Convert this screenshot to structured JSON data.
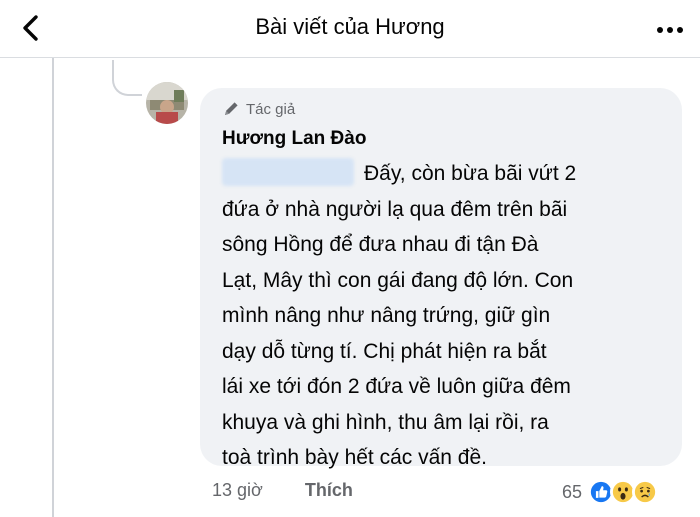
{
  "header": {
    "title": "Bài viết của Hương",
    "back_icon": "chevron-left-icon",
    "more_icon": "more-dots-icon"
  },
  "comment": {
    "author_badge": "Tác giả",
    "author_badge_icon": "pen-icon",
    "author_name": "Hương Lan Đào",
    "lines": [
      "Đấy, còn bừa bãi vứt 2",
      "đứa ở nhà người lạ qua đêm trên bãi",
      "sông Hồng để đưa nhau đi tận Đà",
      "Lạt, Mây thì con gái đang độ lớn. Con",
      "mình nâng như nâng trứng, giữ gìn",
      "dạy dỗ từng tí. Chị phát hiện ra bắt",
      "lái xe tới đón 2 đứa về luôn giữa đêm",
      "khuya và ghi hình, thu âm lại rồi, ra",
      "toà trình bày hết các vấn đề."
    ],
    "time": "13 giờ",
    "like_label": "Thích",
    "reaction_count": "65",
    "reactions": [
      "like-reaction-icon",
      "wow-reaction-icon",
      "sad-reaction-icon"
    ]
  },
  "colors": {
    "bubble_bg": "#f0f2f5",
    "secondary_text": "#65676b",
    "like_blue": "#1877f2",
    "emoji_yellow": "#f7c948"
  }
}
